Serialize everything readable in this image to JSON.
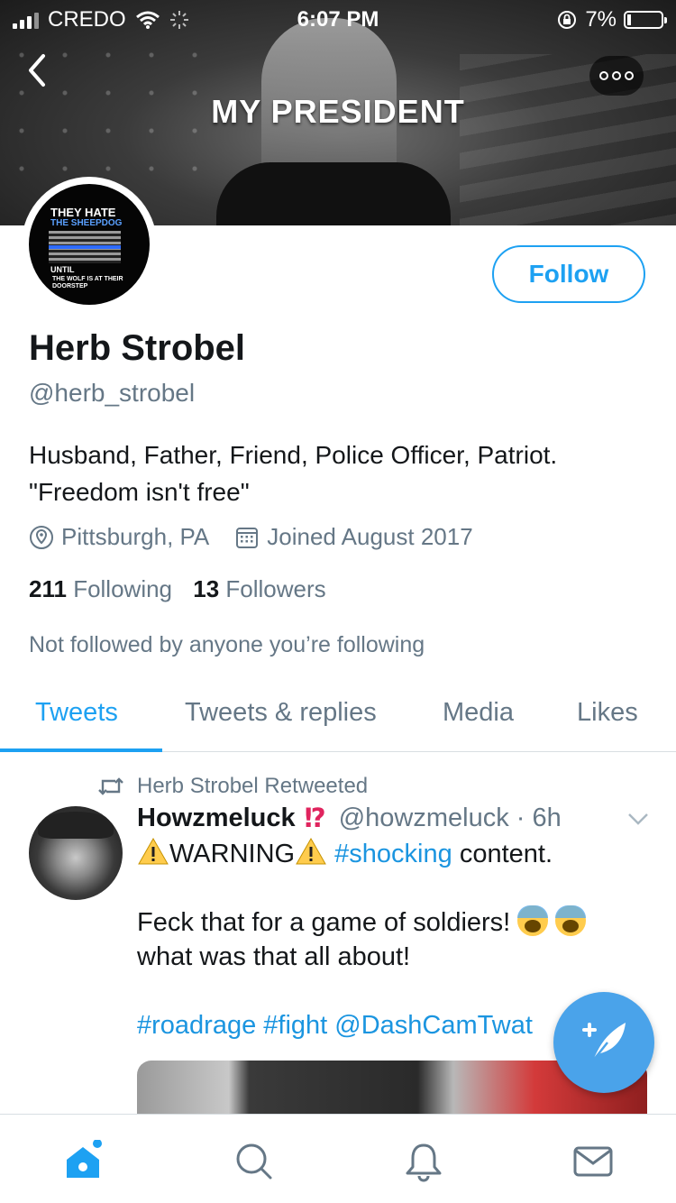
{
  "status_bar": {
    "carrier": "CREDO",
    "time": "6:07 PM",
    "battery": "7%"
  },
  "banner": {
    "text": "MY PRESIDENT"
  },
  "avatar": {
    "line1": "THEY HATE",
    "line2": "THE SHEEPDOG",
    "line3": "UNTIL",
    "line4": "THE WOLF IS AT THEIR DOORSTEP"
  },
  "profile": {
    "follow_label": "Follow",
    "name": "Herb Strobel",
    "handle": "@herb_strobel",
    "bio_line1": "Husband, Father, Friend, Police Officer, Patriot.",
    "bio_line2": "\"Freedom isn't free\"",
    "location": "Pittsburgh, PA",
    "joined": "Joined August 2017",
    "following_count": "211",
    "following_label": "Following",
    "followers_count": "13",
    "followers_label": "Followers",
    "not_followed": "Not followed by anyone you’re following"
  },
  "tabs": [
    {
      "label": "Tweets"
    },
    {
      "label": "Tweets & replies"
    },
    {
      "label": "Media"
    },
    {
      "label": "Likes"
    }
  ],
  "tweet": {
    "retweeted_by": "Herb Strobel Retweeted",
    "author_name": "Howzmeluck",
    "author_marks": "⁉",
    "author_handle_time": "@howzmeluck · 6h",
    "warning_word": "WARNING",
    "hashtag_shocking": "#shocking",
    "content_word": "content.",
    "line2": "Feck that for a game of soldiers!",
    "line3": "what was that all about!",
    "hashtag_roadrage": "#roadrage",
    "hashtag_fight": "#fight",
    "mention": "@DashCamTwat"
  },
  "icons": {
    "back": "back-icon",
    "more": "more-icon",
    "location": "location-pin-icon",
    "calendar": "calendar-icon",
    "retweet": "retweet-icon",
    "caret": "chevron-down-icon",
    "compose": "compose-icon",
    "home": "home-icon",
    "search": "search-icon",
    "notifications": "bell-icon",
    "messages": "mail-icon"
  },
  "colors": {
    "accent": "#1da1f2",
    "secondary_text": "#657786",
    "fab": "#4aa3ea",
    "alert_red": "#e0245e"
  }
}
